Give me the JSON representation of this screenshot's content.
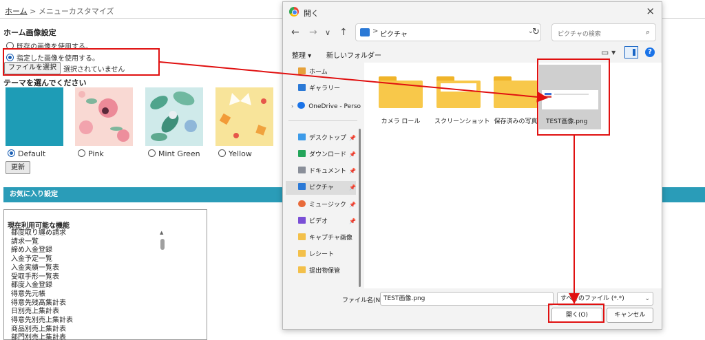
{
  "page": {
    "breadcrumb_home": "ホーム",
    "breadcrumb_sep": ">",
    "breadcrumb_current": "メニューカスタマイズ",
    "home_image_title": "ホーム画像設定",
    "opt_existing": "既存の画像を使用する。",
    "opt_custom": "指定した画像を使用する。",
    "file_button": "ファイルを選択",
    "no_file": "選択されていません",
    "theme_title": "テーマを選んでください",
    "themes": [
      {
        "label": "Default",
        "selected": true
      },
      {
        "label": "Pink",
        "selected": false
      },
      {
        "label": "Mint Green",
        "selected": false
      },
      {
        "label": "Yellow",
        "selected": false
      }
    ],
    "update_button": "更新",
    "favorites_title": "お気に入り設定",
    "available_title": "現在利用可能な機能",
    "available_items": [
      "都度取り纏め請求",
      "請求一覧",
      "締め入金登録",
      "入金予定一覧",
      "入金実績一覧表",
      "受取手形一覧表",
      "都度入金登録",
      "得意先元帳",
      "得意先残高集計表",
      "日別売上集計表",
      "得意先別売上集計表",
      "商品別売上集計表",
      "部門別売上集計表"
    ]
  },
  "dialog": {
    "title": "開く",
    "close_icon": "×",
    "back_icon": "←",
    "forward_icon": "→",
    "recent_icon": "∨",
    "up_icon": "↑",
    "address_sep": ">",
    "address": "ピクチャ",
    "address_chev": "⌄",
    "refresh_icon": "↻",
    "search_placeholder": "ピクチャの検索",
    "search_icon": "⌕",
    "organize": "整理 ▾",
    "new_folder": "新しいフォルダー",
    "view_icon": "▭ ▾",
    "help_icon": "?",
    "nav_items": [
      {
        "label": "ホーム",
        "pin": ""
      },
      {
        "label": "ギャラリー",
        "pin": ""
      },
      {
        "label": "OneDrive - Perso",
        "pin": ""
      },
      {
        "label": "デスクトップ",
        "pin": "📌"
      },
      {
        "label": "ダウンロード",
        "pin": "📌"
      },
      {
        "label": "ドキュメント",
        "pin": "📌"
      },
      {
        "label": "ピクチャ",
        "pin": "📌"
      },
      {
        "label": "ミュージック",
        "pin": "📌"
      },
      {
        "label": "ビデオ",
        "pin": "📌"
      },
      {
        "label": "キャプチャ画像",
        "pin": ""
      },
      {
        "label": "レシート",
        "pin": ""
      },
      {
        "label": "提出物保管",
        "pin": ""
      }
    ],
    "folders": [
      "カメラ ロール",
      "スクリーンショット",
      "保存済みの写真"
    ],
    "file_name": "TEST画像.png",
    "filename_label": "ファイル名(N):",
    "filename_value": "TEST画像.png",
    "filetype": "すべてのファイル (*.*)",
    "filetype_chev": "⌄",
    "open_button": "開く(O)",
    "cancel_button": "キャンセル"
  },
  "colors": {
    "accent_bar": "#2a9cb8",
    "highlight": "#e01010",
    "default_theme": "#1e9cb6"
  }
}
